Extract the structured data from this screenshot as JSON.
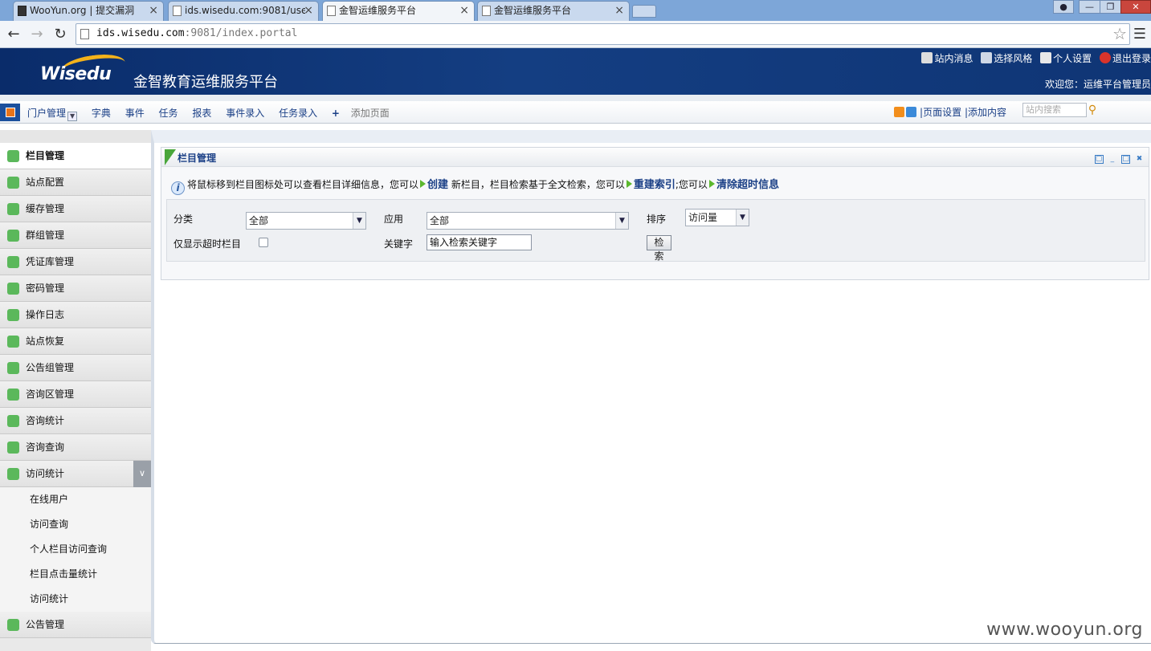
{
  "browser": {
    "tabs": [
      {
        "title": "WooYun.org | 提交漏洞",
        "active": false
      },
      {
        "title": "ids.wisedu.com:9081/use",
        "active": false
      },
      {
        "title": "金智运维服务平台",
        "active": true
      },
      {
        "title": "金智运维服务平台",
        "active": false
      }
    ],
    "url_host": "ids.wisedu.com",
    "url_rest": ":9081/index.portal",
    "close_glyph": "×"
  },
  "header": {
    "logo": "Wisedu",
    "title": "金智教育运维服务平台",
    "links": [
      {
        "label": "站内消息",
        "icon": "speaker-icon",
        "color": "#dddddd"
      },
      {
        "label": "选择风格",
        "icon": "palette-icon",
        "color": "#cfd8e6"
      },
      {
        "label": "个人设置",
        "icon": "person-icon",
        "color": "#e8e8e8"
      },
      {
        "label": "退出登录",
        "icon": "power-icon",
        "color": "#d9342b"
      }
    ],
    "welcome": "欢迎您：运维平台管理员"
  },
  "menu": {
    "items": [
      "门户管理",
      "字典",
      "事件",
      "任务",
      "报表",
      "事件录入",
      "任务录入"
    ],
    "add_page": "添加页面",
    "plus": "+",
    "right": {
      "separator": "|",
      "page_settings": "页面设置",
      "add_content": "添加内容",
      "search_placeholder": "站内搜索"
    }
  },
  "sidebar": {
    "items": [
      {
        "label": "栏目管理",
        "active": true
      },
      {
        "label": "站点配置"
      },
      {
        "label": "缓存管理"
      },
      {
        "label": "群组管理"
      },
      {
        "label": "凭证库管理"
      },
      {
        "label": "密码管理"
      },
      {
        "label": "操作日志"
      },
      {
        "label": "站点恢复"
      },
      {
        "label": "公告组管理"
      },
      {
        "label": "咨询区管理"
      },
      {
        "label": "咨询统计"
      },
      {
        "label": "咨询查询"
      },
      {
        "label": "访问统计",
        "expanded": true
      }
    ],
    "sub_items": [
      "在线用户",
      "访问查询",
      "个人栏目访问查询",
      "栏目点击量统计",
      "访问统计"
    ],
    "last_item": "公告管理"
  },
  "portlet": {
    "title": "栏目管理",
    "info": {
      "text1": "将鼠标移到栏目图标处可以查看栏目详细信息，您可以",
      "link_create": "创建",
      "text2": "新栏目，栏目检索基于全文检索，您可以",
      "link_reindex": "重建索引",
      "text3": ";您可以",
      "link_clear": "清除超时信息"
    },
    "filter": {
      "category_label": "分类",
      "category_value": "全部",
      "app_label": "应用",
      "app_value": "全部",
      "sort_label": "排序",
      "sort_value": "访问量",
      "timeout_label": "仅显示超时栏目",
      "keyword_label": "关键字",
      "keyword_value": "输入检索关键字",
      "search_button": "检 索"
    }
  },
  "watermark": "www.wooyun.org"
}
